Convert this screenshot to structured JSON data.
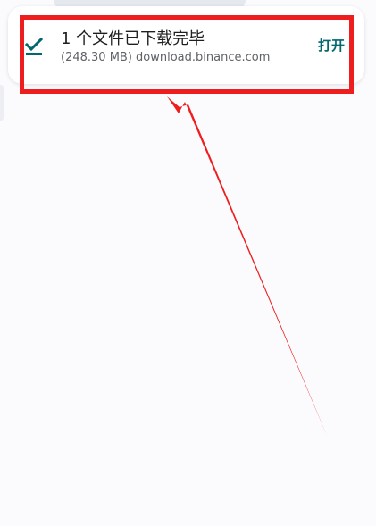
{
  "notification": {
    "title": "1 个文件已下载完毕",
    "subtitle": "(248.30 MB) download.binance.com",
    "action_label": "打开",
    "icon": "download-done-check-icon"
  },
  "annotation": {
    "color": "#ee1e1e"
  },
  "colors": {
    "accent": "#00696f",
    "background": "#fbfbfe"
  }
}
